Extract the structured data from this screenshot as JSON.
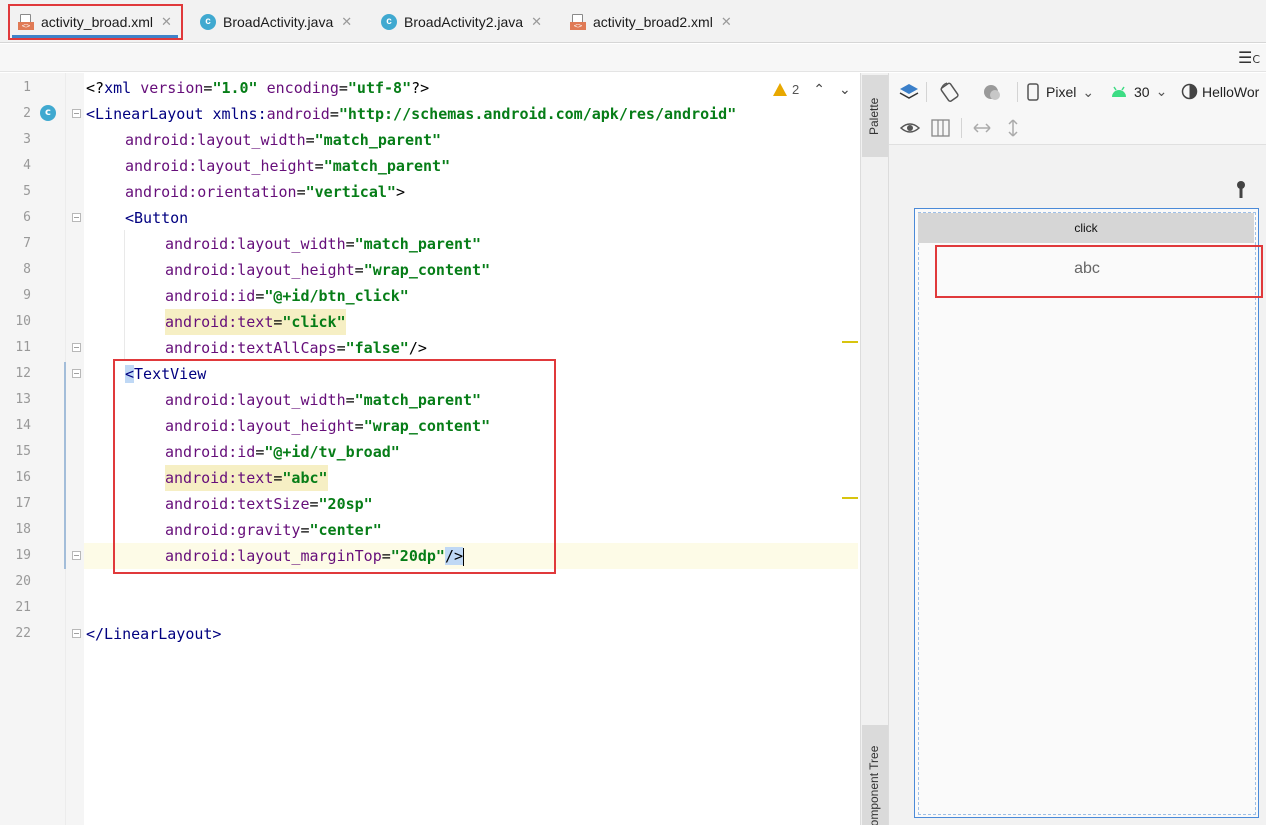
{
  "tabs": [
    {
      "label": "activity_broad.xml",
      "type": "xml",
      "active": true
    },
    {
      "label": "BroadActivity.java",
      "type": "java",
      "active": false
    },
    {
      "label": "BroadActivity2.java",
      "type": "java",
      "active": false
    },
    {
      "label": "activity_broad2.xml",
      "type": "xml",
      "active": false
    }
  ],
  "icons": {
    "close": "✕",
    "java": "c",
    "xml": "<>",
    "chevron_up": "⌃",
    "chevron_down": "⌄",
    "structure": "☰"
  },
  "tool_row": {
    "structure_label": "C"
  },
  "editor": {
    "warning_count": "2",
    "lines": [
      {
        "n": "1"
      },
      {
        "n": "2"
      },
      {
        "n": "3"
      },
      {
        "n": "4"
      },
      {
        "n": "5"
      },
      {
        "n": "6"
      },
      {
        "n": "7"
      },
      {
        "n": "8"
      },
      {
        "n": "9"
      },
      {
        "n": "10"
      },
      {
        "n": "11"
      },
      {
        "n": "12"
      },
      {
        "n": "13"
      },
      {
        "n": "14"
      },
      {
        "n": "15"
      },
      {
        "n": "16"
      },
      {
        "n": "17"
      },
      {
        "n": "18"
      },
      {
        "n": "19"
      },
      {
        "n": "20"
      },
      {
        "n": "21"
      },
      {
        "n": "22"
      }
    ],
    "code": {
      "l1_open": "<?",
      "l1_xml": "xml ",
      "l1_version": "version",
      "l1_eq": "=",
      "l1_version_val": "\"1.0\"",
      "l1_encoding": " encoding",
      "l1_encoding_val": "\"utf-8\"",
      "l1_close": "?>",
      "l2_tag": "<LinearLayout ",
      "l2_attr_ns": "xmlns:",
      "l2_attr": "android",
      "l2_val": "\"http://schemas.android.com/apk/res/android\"",
      "ns": "android",
      "colon": ":",
      "layout_width": "layout_width",
      "layout_height": "layout_height",
      "orientation": "orientation",
      "match_parent": "\"match_parent\"",
      "wrap_content": "\"wrap_content\"",
      "vertical": "\"vertical\"",
      "gt": ">",
      "btn_tag": "<Button",
      "id": "id",
      "btn_id": "\"@+id/btn_click\"",
      "text": "text",
      "btn_text": "\"click\"",
      "textAllCaps": "textAllCaps",
      "false_val": "\"false\"",
      "selfclose": "/>",
      "tv_lt": "<",
      "tv_tag": "TextView",
      "tv_id": "\"@+id/tv_broad\"",
      "tv_text": "\"abc\"",
      "textSize": "textSize",
      "tv_size": "\"20sp\"",
      "gravity": "gravity",
      "center": "\"center\"",
      "marginTop": "layout_marginTop",
      "margin_val": "\"20dp\"",
      "l22": "</LinearLayout>"
    }
  },
  "side_strip": {
    "palette_label": "Palette",
    "component_tree_label": "Component Tree"
  },
  "design_toolbar": {
    "device": "Pixel",
    "api": "30",
    "theme": "HelloWor"
  },
  "preview": {
    "button_text": "click",
    "textview_text": "abc"
  },
  "colors": {
    "highlight_box": "#e0393b",
    "tab_underline": "#4083c9",
    "string_value": "#067d17",
    "attribute": "#660e7a",
    "tag": "#000080"
  }
}
